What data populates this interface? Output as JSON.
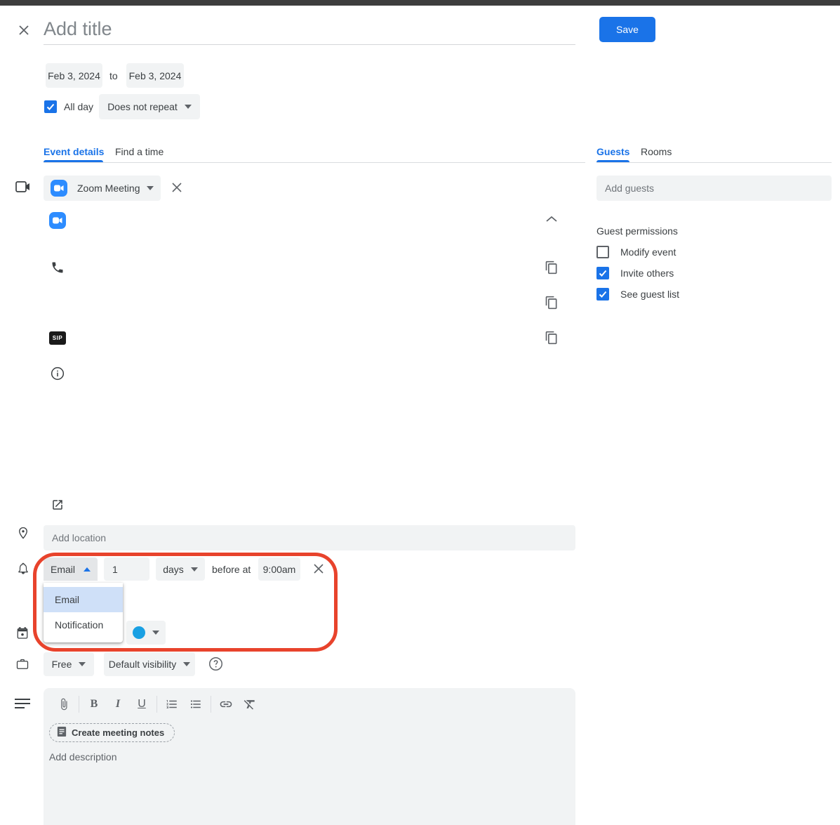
{
  "header": {
    "title_placeholder": "Add title",
    "save_label": "Save"
  },
  "dates": {
    "start": "Feb 3, 2024",
    "to_label": "to",
    "end": "Feb 3, 2024",
    "all_day_label": "All day",
    "all_day_checked": true,
    "recurrence": "Does not repeat"
  },
  "tabs": {
    "event_details": "Event details",
    "find_a_time": "Find a time",
    "active_left": "Event details",
    "guests": "Guests",
    "rooms": "Rooms",
    "active_right": "Guests"
  },
  "conferencing": {
    "provider": "Zoom Meeting",
    "sip_label": "SIP"
  },
  "location": {
    "placeholder": "Add location"
  },
  "notification": {
    "type": "Email",
    "count": "1",
    "unit": "days",
    "before_label": "before at",
    "time": "9:00am",
    "menu_open": true,
    "menu_options": [
      "Email",
      "Notification"
    ],
    "menu_selected": "Email"
  },
  "status": {
    "availability": "Free",
    "visibility": "Default visibility"
  },
  "description": {
    "create_notes_label": "Create meeting notes",
    "placeholder": "Add description"
  },
  "guests_panel": {
    "add_placeholder": "Add guests",
    "permissions_title": "Guest permissions",
    "permissions": [
      {
        "label": "Modify event",
        "checked": false
      },
      {
        "label": "Invite others",
        "checked": true
      },
      {
        "label": "See guest list",
        "checked": true
      }
    ]
  },
  "colors": {
    "accent_blue": "#1a73e8",
    "zoom_blue": "#2d8cff",
    "calendar_color_dot": "#19a0e3",
    "annotation_red": "#e8432c",
    "chip_bg": "#f1f3f4",
    "menu_highlight": "#cfe0f8"
  },
  "icons": [
    "close-icon",
    "videocam-icon",
    "zoom-logo-icon",
    "chevron-up-icon",
    "phone-icon",
    "copy-icon",
    "sip-badge",
    "info-icon",
    "open-in-new-icon",
    "location-pin-icon",
    "bell-icon",
    "calendar-icon",
    "briefcase-icon",
    "help-icon",
    "notes-lines-icon",
    "attach-icon",
    "bold-icon",
    "italic-icon",
    "underline-icon",
    "numbered-list-icon",
    "bulleted-list-icon",
    "link-icon",
    "clear-format-icon",
    "doc-icon"
  ]
}
